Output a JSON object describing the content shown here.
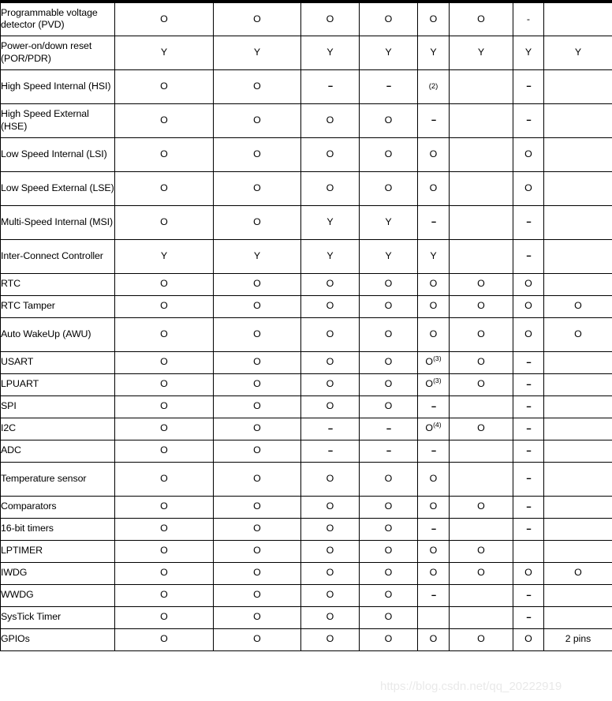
{
  "document": {
    "kind": "datasheet-feature-comparison-table",
    "watermark_text": "https://blog.csdn.net/qq_20222919"
  },
  "table": {
    "columns": [
      {
        "key": "feature",
        "header": ""
      },
      {
        "key": "col1",
        "header": ""
      },
      {
        "key": "col2",
        "header": ""
      },
      {
        "key": "col3",
        "header": ""
      },
      {
        "key": "col4",
        "header": ""
      },
      {
        "key": "col5",
        "header": ""
      },
      {
        "key": "col6",
        "header": ""
      },
      {
        "key": "col7",
        "header": ""
      },
      {
        "key": "col8",
        "header": ""
      }
    ],
    "rows": [
      {
        "feature": "Programmable voltage detector (PVD)",
        "tall": true,
        "values": [
          "O",
          "O",
          "O",
          "O",
          "O",
          "O",
          "-",
          ""
        ]
      },
      {
        "feature": "Power-on/down reset (POR/PDR)",
        "tall": true,
        "values": [
          "Y",
          "Y",
          "Y",
          "Y",
          "Y",
          "Y",
          "Y",
          "Y"
        ]
      },
      {
        "feature": "High Speed Internal (HSI)",
        "tall": true,
        "values": [
          "O",
          "O",
          "--",
          "--",
          "(2)",
          "",
          "--",
          ""
        ]
      },
      {
        "feature": "High Speed External (HSE)",
        "tall": true,
        "values": [
          "O",
          "O",
          "O",
          "O",
          "--",
          "",
          "--",
          ""
        ]
      },
      {
        "feature": "Low Speed Internal (LSI)",
        "tall": true,
        "values": [
          "O",
          "O",
          "O",
          "O",
          "O",
          "",
          "O",
          ""
        ]
      },
      {
        "feature": "Low Speed External (LSE)",
        "tall": true,
        "values": [
          "O",
          "O",
          "O",
          "O",
          "O",
          "",
          "O",
          ""
        ]
      },
      {
        "feature": "Multi-Speed Internal (MSI)",
        "tall": true,
        "values": [
          "O",
          "O",
          "Y",
          "Y",
          "--",
          "",
          "--",
          ""
        ]
      },
      {
        "feature": "Inter-Connect Controller",
        "tall": true,
        "values": [
          "Y",
          "Y",
          "Y",
          "Y",
          "Y",
          "",
          "--",
          ""
        ]
      },
      {
        "feature": "RTC",
        "tall": false,
        "values": [
          "O",
          "O",
          "O",
          "O",
          "O",
          "O",
          "O",
          ""
        ]
      },
      {
        "feature": "RTC Tamper",
        "tall": false,
        "values": [
          "O",
          "O",
          "O",
          "O",
          "O",
          "O",
          "O",
          "O"
        ]
      },
      {
        "feature": "Auto WakeUp (AWU)",
        "tall": true,
        "values": [
          "O",
          "O",
          "O",
          "O",
          "O",
          "O",
          "O",
          "O"
        ]
      },
      {
        "feature": "USART",
        "tall": false,
        "values": [
          "O",
          "O",
          "O",
          "O",
          "O(3)",
          "O",
          "--",
          ""
        ]
      },
      {
        "feature": "LPUART",
        "tall": false,
        "values": [
          "O",
          "O",
          "O",
          "O",
          "O(3)",
          "O",
          "--",
          ""
        ]
      },
      {
        "feature": "SPI",
        "tall": false,
        "values": [
          "O",
          "O",
          "O",
          "O",
          "--",
          "",
          "--",
          ""
        ]
      },
      {
        "feature": "I2C",
        "tall": false,
        "values": [
          "O",
          "O",
          "--",
          "--",
          "O(4)",
          "O",
          "--",
          ""
        ]
      },
      {
        "feature": "ADC",
        "tall": false,
        "values": [
          "O",
          "O",
          "--",
          "--",
          "--",
          "",
          "--",
          ""
        ]
      },
      {
        "feature": "Temperature sensor",
        "tall": true,
        "values": [
          "O",
          "O",
          "O",
          "O",
          "O",
          "",
          "--",
          ""
        ]
      },
      {
        "feature": "Comparators",
        "tall": false,
        "values": [
          "O",
          "O",
          "O",
          "O",
          "O",
          "O",
          "--",
          ""
        ]
      },
      {
        "feature": "16-bit timers",
        "tall": false,
        "values": [
          "O",
          "O",
          "O",
          "O",
          "--",
          "",
          "--",
          ""
        ]
      },
      {
        "feature": "LPTIMER",
        "tall": false,
        "values": [
          "O",
          "O",
          "O",
          "O",
          "O",
          "O",
          "",
          ""
        ]
      },
      {
        "feature": "IWDG",
        "tall": false,
        "values": [
          "O",
          "O",
          "O",
          "O",
          "O",
          "O",
          "O",
          "O"
        ]
      },
      {
        "feature": "WWDG",
        "tall": false,
        "values": [
          "O",
          "O",
          "O",
          "O",
          "--",
          "",
          "--",
          ""
        ]
      },
      {
        "feature": "SysTick Timer",
        "tall": false,
        "values": [
          "O",
          "O",
          "O",
          "O",
          "",
          "",
          "--",
          ""
        ]
      },
      {
        "feature": "GPIOs",
        "tall": false,
        "values": [
          "O",
          "O",
          "O",
          "O",
          "O",
          "O",
          "O",
          "2 pins"
        ]
      }
    ]
  }
}
